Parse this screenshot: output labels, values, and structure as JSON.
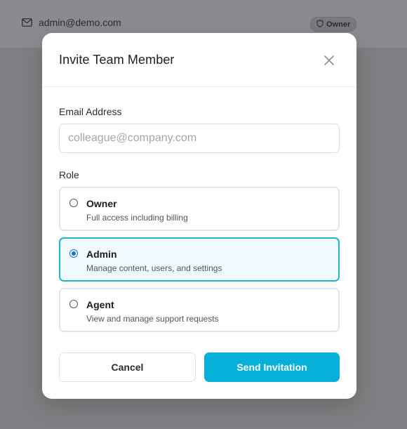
{
  "background": {
    "user_email": "admin@demo.com",
    "role_badge": "Owner",
    "email_icon": "mail-icon",
    "badge_icon": "shield-icon"
  },
  "modal": {
    "title": "Invite Team Member",
    "close_icon": "close-icon",
    "email_label": "Email Address",
    "email_placeholder": "colleague@company.com",
    "email_value": "",
    "role_label": "Role",
    "roles": [
      {
        "name": "Owner",
        "description": "Full access including billing",
        "selected": false
      },
      {
        "name": "Admin",
        "description": "Manage content, users, and settings",
        "selected": true
      },
      {
        "name": "Agent",
        "description": "View and manage support requests",
        "selected": false
      }
    ],
    "cancel_label": "Cancel",
    "send_label": "Send Invitation"
  },
  "colors": {
    "accent": "#06b0d8",
    "selected_border": "#1fb3d6",
    "selected_bg": "#f0f9fd",
    "overlay": "#7f8083"
  }
}
